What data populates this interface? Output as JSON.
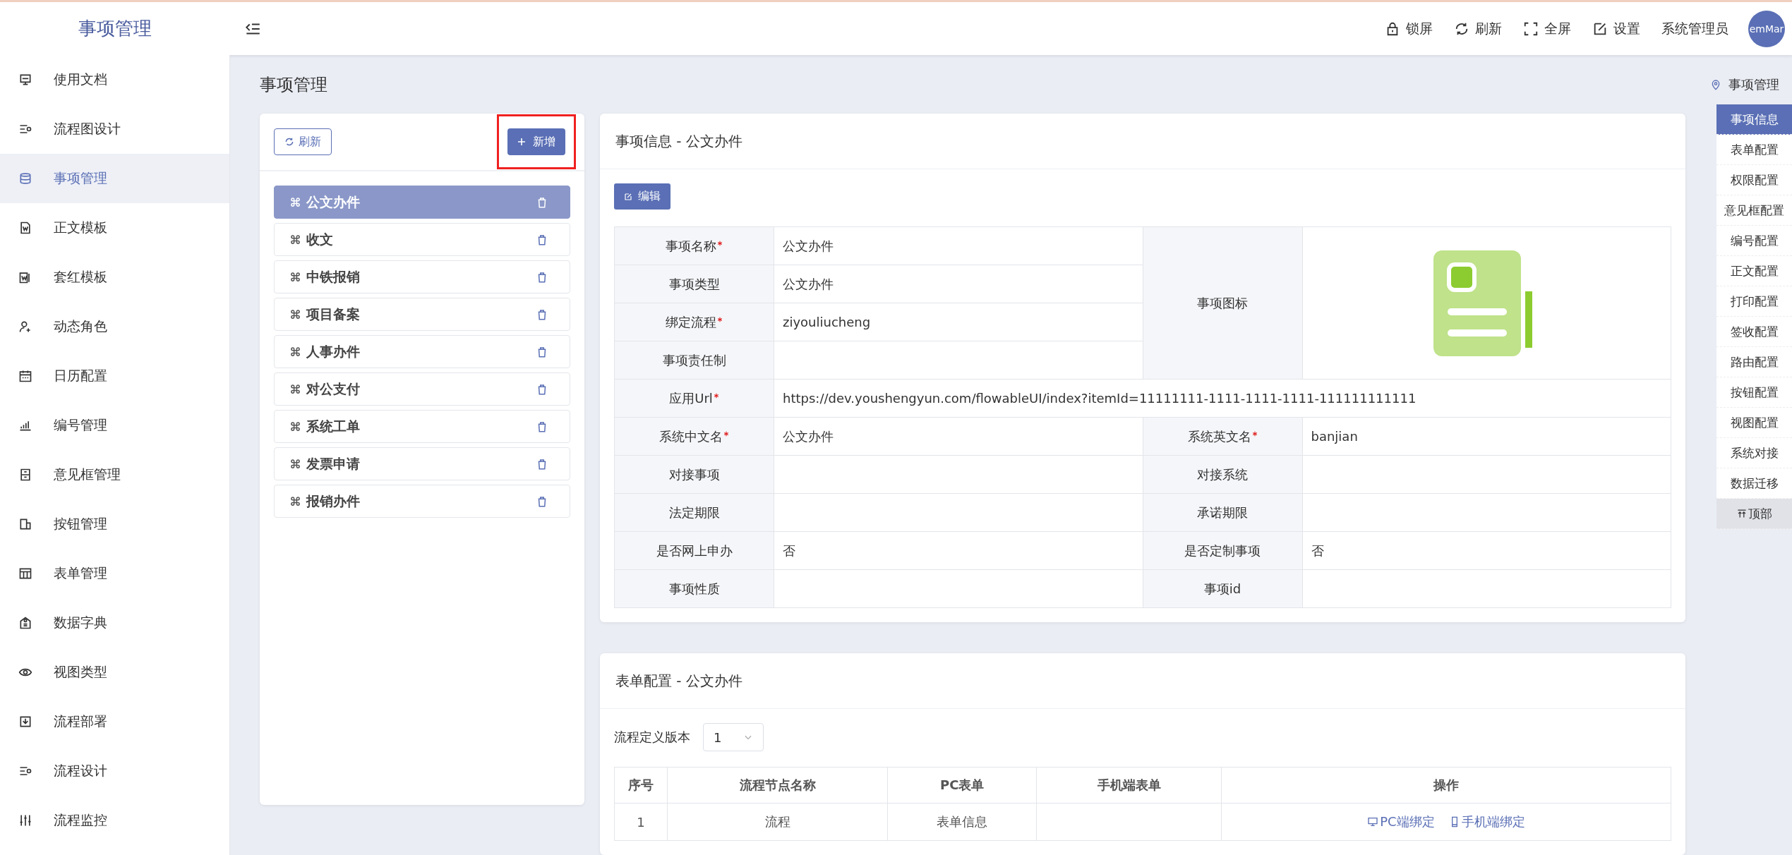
{
  "header": {
    "title": "事项管理",
    "tools": [
      {
        "label": "锁屏"
      },
      {
        "label": "刷新"
      },
      {
        "label": "全屏"
      },
      {
        "label": "设置"
      }
    ],
    "user": "系统管理员",
    "avatar_text": "emMar"
  },
  "sidebar": {
    "items": [
      {
        "label": "使用文档",
        "selected": false
      },
      {
        "label": "流程图设计",
        "selected": false
      },
      {
        "label": "事项管理",
        "selected": true
      },
      {
        "label": "正文模板",
        "selected": false
      },
      {
        "label": "套红模板",
        "selected": false
      },
      {
        "label": "动态角色",
        "selected": false
      },
      {
        "label": "日历配置",
        "selected": false
      },
      {
        "label": "编号管理",
        "selected": false
      },
      {
        "label": "意见框管理",
        "selected": false
      },
      {
        "label": "按钮管理",
        "selected": false
      },
      {
        "label": "表单管理",
        "selected": false
      },
      {
        "label": "数据字典",
        "selected": false
      },
      {
        "label": "视图类型",
        "selected": false
      },
      {
        "label": "流程部署",
        "selected": false
      },
      {
        "label": "流程设计",
        "selected": false
      },
      {
        "label": "流程监控",
        "selected": false
      }
    ]
  },
  "page_title": "事项管理",
  "breadcrumb": "事项管理",
  "list_panel": {
    "refresh_button": "刷新",
    "add_button": {
      "label": "新增",
      "highlighted": true
    },
    "items": [
      {
        "label": "公文办件",
        "selected": true
      },
      {
        "label": "收文",
        "selected": false
      },
      {
        "label": "中铁报销",
        "selected": false
      },
      {
        "label": "项目备案",
        "selected": false
      },
      {
        "label": "人事办件",
        "selected": false
      },
      {
        "label": "对公支付",
        "selected": false
      },
      {
        "label": "系统工单",
        "selected": false
      },
      {
        "label": "发票申请",
        "selected": false
      },
      {
        "label": "报销办件",
        "selected": false
      }
    ]
  },
  "info_card": {
    "title": "事项信息 - 公文办件",
    "edit_button": "编辑",
    "top_fields": [
      {
        "label": "事项名称",
        "required": true,
        "value": "公文办件"
      },
      {
        "label": "事项类型",
        "required": false,
        "value": "公文办件"
      },
      {
        "label": "绑定流程",
        "required": true,
        "value": "ziyouliucheng"
      },
      {
        "label": "事项责任制",
        "required": false
      }
    ],
    "icon_label": "事项图标",
    "url_field": {
      "label": "应用Url",
      "required": true,
      "value": "https://dev.youshengyun.com/flowableUI/index?itemId=11111111-1111-1111-1111-111111111111"
    },
    "pair_rows": [
      [
        {
          "label": "系统中文名",
          "required": true,
          "value": "公文办件"
        },
        {
          "label": "系统英文名",
          "required": true,
          "value": "banjian"
        }
      ],
      [
        {
          "label": "对接事项",
          "required": false
        },
        {
          "label": "对接系统",
          "required": false
        }
      ],
      [
        {
          "label": "法定期限",
          "required": false
        },
        {
          "label": "承诺期限",
          "required": false
        }
      ],
      [
        {
          "label": "是否网上申办",
          "required": false,
          "value": "否"
        },
        {
          "label": "是否定制事项",
          "required": false,
          "value": "否"
        }
      ],
      [
        {
          "label": "事项性质",
          "required": false
        },
        {
          "label": "事项id",
          "required": false
        }
      ]
    ]
  },
  "form_card": {
    "title": "表单配置 - 公文办件",
    "version_label": "流程定义版本",
    "version_value": "1",
    "columns": [
      "序号",
      "流程节点名称",
      "PC表单",
      "手机端表单",
      "操作"
    ],
    "rows": [
      {
        "index": "1",
        "node": "流程",
        "pc_form": "表单信息",
        "actions": [
          "PC端绑定",
          "手机端绑定"
        ]
      }
    ]
  },
  "right_nav": {
    "items": [
      {
        "label": "事项信息",
        "selected": true
      },
      {
        "label": "表单配置",
        "selected": false
      },
      {
        "label": "权限配置",
        "selected": false
      },
      {
        "label": "意见框配置",
        "selected": false
      },
      {
        "label": "编号配置",
        "selected": false
      },
      {
        "label": "正文配置",
        "selected": false
      },
      {
        "label": "打印配置",
        "selected": false
      },
      {
        "label": "签收配置",
        "selected": false
      },
      {
        "label": "路由配置",
        "selected": false
      },
      {
        "label": "按钮配置",
        "selected": false
      },
      {
        "label": "视图配置",
        "selected": false
      },
      {
        "label": "系统对接",
        "selected": false
      },
      {
        "label": "数据迁移",
        "selected": false
      }
    ],
    "top_button": "顶部"
  }
}
